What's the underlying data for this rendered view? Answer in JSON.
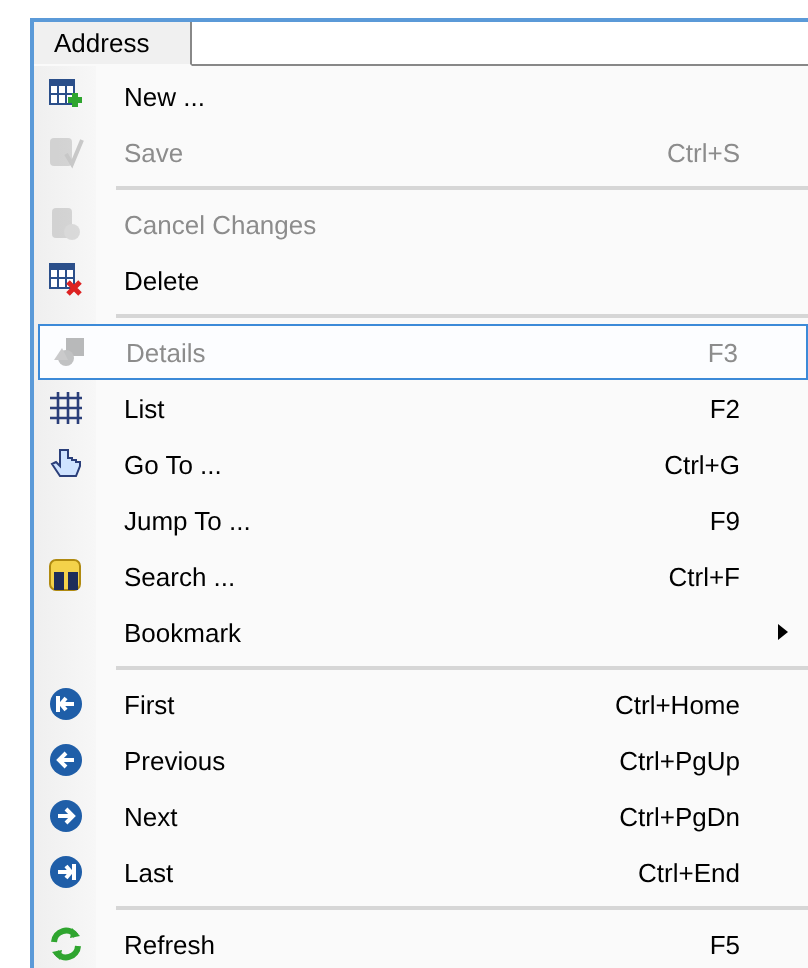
{
  "tab": {
    "label": "Address"
  },
  "items": [
    {
      "kind": "item",
      "label": "New ...",
      "disabled": false,
      "selected": false,
      "submenu": false
    },
    {
      "kind": "item",
      "label": "Save",
      "shortcut": "Ctrl+S",
      "disabled": true,
      "selected": false,
      "submenu": false
    },
    {
      "kind": "separator"
    },
    {
      "kind": "item",
      "label": "Cancel Changes",
      "disabled": true,
      "selected": false,
      "submenu": false
    },
    {
      "kind": "item",
      "label": "Delete",
      "disabled": false,
      "selected": false,
      "submenu": false
    },
    {
      "kind": "separator"
    },
    {
      "kind": "item",
      "label": "Details",
      "shortcut": "F3",
      "disabled": true,
      "selected": true,
      "submenu": false
    },
    {
      "kind": "item",
      "label": "List",
      "shortcut": "F2",
      "disabled": false,
      "selected": false,
      "submenu": false
    },
    {
      "kind": "item",
      "label": "Go To ...",
      "shortcut": "Ctrl+G",
      "disabled": false,
      "selected": false,
      "submenu": false
    },
    {
      "kind": "item",
      "label": "Jump To ...",
      "shortcut": "F9",
      "disabled": false,
      "selected": false,
      "submenu": false
    },
    {
      "kind": "item",
      "label": "Search ...",
      "shortcut": "Ctrl+F",
      "disabled": false,
      "selected": false,
      "submenu": false
    },
    {
      "kind": "item",
      "label": "Bookmark",
      "disabled": false,
      "selected": false,
      "submenu": true
    },
    {
      "kind": "separator"
    },
    {
      "kind": "item",
      "label": "First",
      "shortcut": "Ctrl+Home",
      "disabled": false,
      "selected": false,
      "submenu": false
    },
    {
      "kind": "item",
      "label": "Previous",
      "shortcut": "Ctrl+PgUp",
      "disabled": false,
      "selected": false,
      "submenu": false
    },
    {
      "kind": "item",
      "label": "Next",
      "shortcut": "Ctrl+PgDn",
      "disabled": false,
      "selected": false,
      "submenu": false
    },
    {
      "kind": "item",
      "label": "Last",
      "shortcut": "Ctrl+End",
      "disabled": false,
      "selected": false,
      "submenu": false
    },
    {
      "kind": "separator"
    },
    {
      "kind": "item",
      "label": "Refresh",
      "shortcut": "F5",
      "disabled": false,
      "selected": false,
      "submenu": false
    }
  ]
}
